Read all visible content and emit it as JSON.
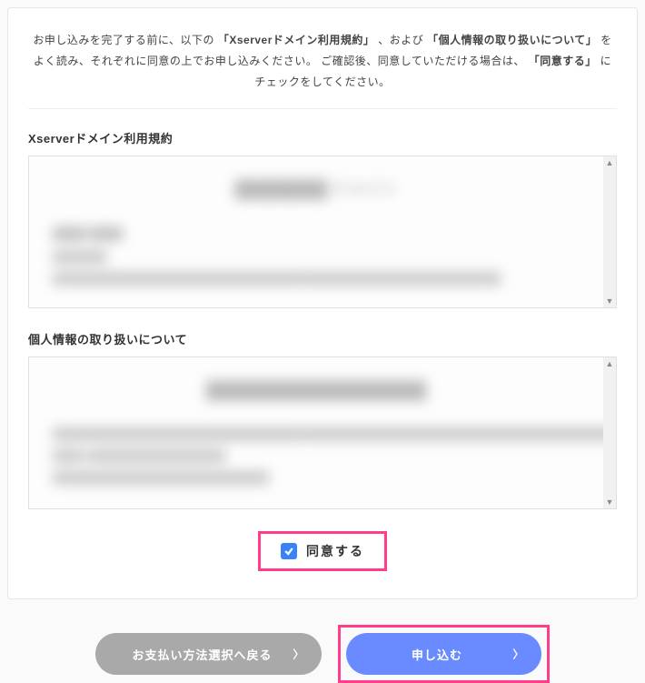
{
  "intro": {
    "pre": "お申し込みを完了する前に、以下の",
    "bold1": "「Xserverドメイン利用規約」",
    "mid1": "、および",
    "bold2": "「個人情報の取り扱いについて」",
    "mid2": "をよく読み、それぞれに同意の上でお申し込みください。 ご確認後、同意していただける場合は、",
    "bold3": "「同意する」",
    "tail": "にチェックをしてください。"
  },
  "sections": {
    "terms_title": "Xserverドメイン利用規約",
    "privacy_title": "個人情報の取り扱いについて"
  },
  "agree": {
    "label": "同意する",
    "checked": true
  },
  "buttons": {
    "back": "お支払い方法選択へ戻る",
    "submit": "申し込む"
  },
  "colors": {
    "highlight": "#ff3d8b",
    "primary": "#6a8bff",
    "checkbox": "#3b82f6"
  }
}
